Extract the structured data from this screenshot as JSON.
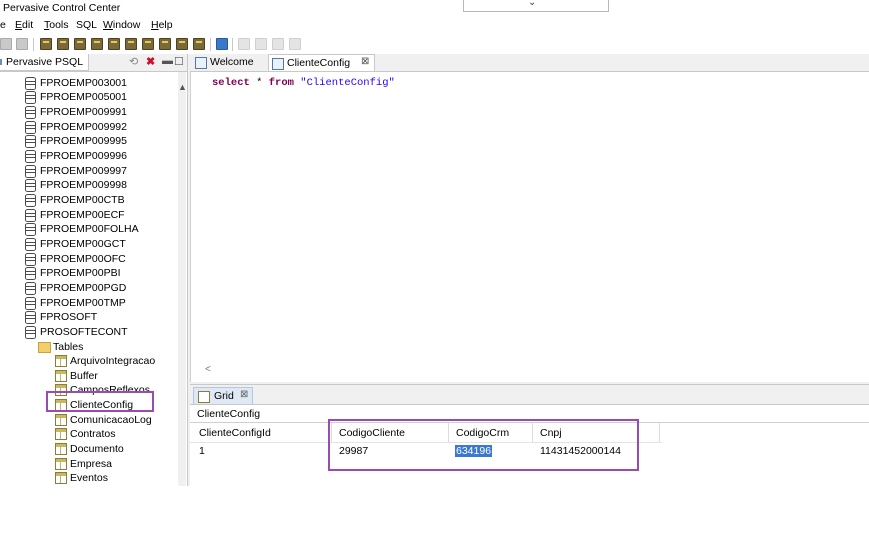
{
  "window": {
    "title": "Pervasive Control Center"
  },
  "menu": [
    {
      "label": "e",
      "u": ""
    },
    {
      "label": "dit",
      "u": "E"
    },
    {
      "label": "ools",
      "u": "T"
    },
    {
      "label": "SQL",
      "u": ""
    },
    {
      "label": "indow",
      "u": "W"
    },
    {
      "label": "elp",
      "u": "H"
    }
  ],
  "navigator": {
    "tab_label": "Pervasive PSQL",
    "databases": [
      "FPROEMP003001",
      "FPROEMP005001",
      "FPROEMP009991",
      "FPROEMP009992",
      "FPROEMP009995",
      "FPROEMP009996",
      "FPROEMP009997",
      "FPROEMP009998",
      "FPROEMP00CTB",
      "FPROEMP00ECF",
      "FPROEMP00FOLHA",
      "FPROEMP00GCT",
      "FPROEMP00OFC",
      "FPROEMP00PBI",
      "FPROEMP00PGD",
      "FPROEMP00TMP",
      "FPROSOFT",
      "PROSOFTECONT"
    ],
    "folder": "Tables",
    "tables": [
      "ArquivoIntegracao",
      "Buffer",
      "CamposReflexos",
      "ClienteConfig",
      "ComunicacaoLog",
      "Contratos",
      "Documento",
      "Empresa",
      "Eventos"
    ]
  },
  "editor": {
    "tabs": [
      {
        "label": "Welcome"
      },
      {
        "label": "ClienteConfig",
        "close": "⊠"
      }
    ],
    "query": {
      "select": "select",
      "star": "*",
      "from": "from",
      "table": "\"ClienteConfig\""
    },
    "scroll_left": "<"
  },
  "grid": {
    "tab_label": "Grid",
    "tab_close": "⊠",
    "result_label": "ClienteConfig",
    "columns": [
      "ClienteConfigId",
      "CodigoCliente",
      "CodigoCrm",
      "Cnpj"
    ],
    "rows": [
      [
        "1",
        "29987",
        "634196",
        "11431452000144"
      ]
    ]
  },
  "colors": {
    "highlight": "#9b4bb0",
    "selection": "#3b79d0"
  }
}
